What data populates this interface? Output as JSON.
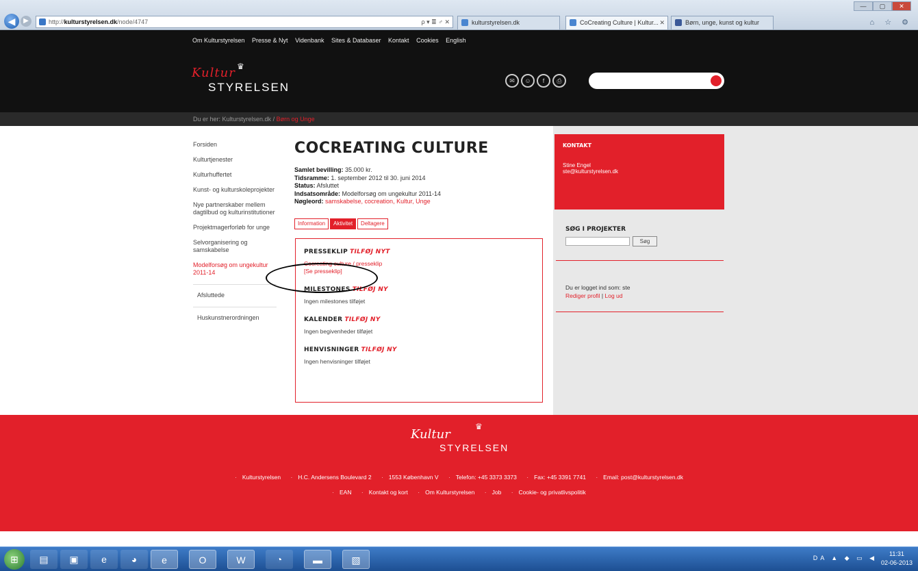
{
  "browser": {
    "address_prefix": "http://",
    "address_domain": "kulturstyrelsen.dk",
    "address_path": "/node/4747",
    "address_tools": "ρ ▾ ≣ ♂ ✕",
    "tabs": [
      {
        "label": "kulturstyrelsen.dk",
        "active": false
      },
      {
        "label": "CoCreating Culture | Kultur...",
        "active": true
      },
      {
        "label": "Børn, unge, kunst og kultur",
        "active": false
      }
    ],
    "win_min": "—",
    "win_max": "▢",
    "win_close": "✕",
    "toolbar_icons": "⌂ ☆ ⚙"
  },
  "site": {
    "topnav": [
      "Om Kulturstyrelsen",
      "Presse & Nyt",
      "Videnbank",
      "Sites & Databaser",
      "Kontakt",
      "Cookies",
      "English"
    ],
    "logo_script": "Kultur",
    "logo_word": "STYRELSEN",
    "share_icons": [
      "✉",
      "☺",
      "f",
      "⎙"
    ],
    "breadcrumb_prefix": "Du er her: Kulturstyrelsen.dk",
    "breadcrumb_sep": "/",
    "breadcrumb_current": "Børn og Unge"
  },
  "left_nav": [
    "Forsiden",
    "Kulturtjenester",
    "Kulturhuffertet",
    "Kunst- og kulturskoleprojekter",
    "Nye partnerskaber mellem dagtilbud og kulturinstitutioner",
    "Projektmagerforløb for unge",
    "Selvorganisering og samskabelse",
    "Modelforsøg om ungekultur 2011-14",
    "Afsluttede",
    "Huskunstnerordningen"
  ],
  "main": {
    "title": "COCREATING CULTURE",
    "meta": {
      "bevilling_label": "Samlet bevilling:",
      "bevilling_value": "35.000 kr.",
      "tidsramme_label": "Tidsramme:",
      "tidsramme_value": "1. september 2012 til 30. juni 2014",
      "status_label": "Status:",
      "status_value": "Afsluttet",
      "indsats_label": "Indsatsområde:",
      "indsats_value": "Modelforsøg om ungekultur 2011-14",
      "noegle_label": "Nøgleord:",
      "noegle_value": "samskabelse, cocreation, Kultur, Unge"
    },
    "tabs": [
      "Information",
      "Aktivitet",
      "Deltagere"
    ],
    "active_tab": "Aktivitet",
    "sections": {
      "presseklip_title": "PRESSEKLIP",
      "presseklip_add": "TILFØJ NYT",
      "presseklip_item": "Cocreating culture / presseklip",
      "presseklip_link": "[Se presseklip]",
      "milestones_title": "MILESTONES",
      "milestones_add": "TILFØJ NY",
      "milestones_body": "Ingen milestones tilføjet",
      "kalender_title": "KALENDER",
      "kalender_add": "TILFØJ NY",
      "kalender_body": "Ingen begivenheder tilføjet",
      "henvisninger_title": "HENVISNINGER",
      "henvisninger_add": "TILFØJ NY",
      "henvisninger_body": "Ingen henvisninger tilføjet"
    }
  },
  "right": {
    "kontakt_title": "KONTAKT",
    "kontakt_name": "Stine Engel",
    "kontakt_email": "ste@kulturstyrelsen.dk",
    "sog_title": "SØG I PROJEKTER",
    "sog_button": "Søg",
    "login_text": "Du er logget ind som: ste",
    "login_edit": "Rediger profil",
    "login_sep": " | ",
    "login_logout": "Log ud"
  },
  "footer": {
    "logo_script": "Kultur",
    "logo_word": "STYRELSEN",
    "row1": [
      "Kulturstyrelsen",
      "H.C. Andersens Boulevard 2",
      "1553 København V",
      "Telefon: +45 3373 3373",
      "Fax: +45 3391 7741",
      "Email: post@kulturstyrelsen.dk"
    ],
    "row2": [
      "EAN",
      "Kontakt og kort",
      "Om Kulturstyrelsen",
      "Job",
      "Cookie- og privatlivspolitik"
    ]
  },
  "taskbar": {
    "start_glyph": "⊞",
    "apps": [
      "▤",
      "▣",
      "e",
      "◕",
      "e",
      "O",
      "W",
      "◔",
      "▬",
      "▧"
    ],
    "tray": "DA ▲ ◆ ▭ ◀",
    "time": "11:31",
    "date": "02-06-2013"
  }
}
